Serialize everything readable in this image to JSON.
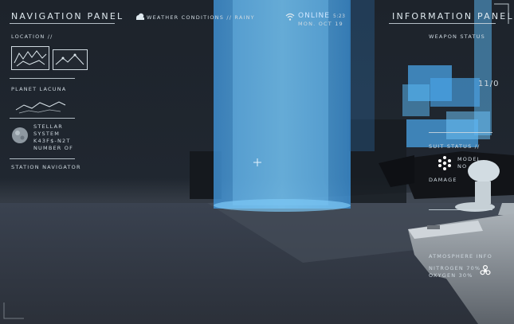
{
  "left_panel": {
    "title": "NAVIGATION PANEL",
    "location_label": "LOCATION //",
    "planet_label": "PLANET LACUNA",
    "system_lines": [
      "STELLAR",
      "SYSTEM",
      "K43F$-N2T",
      "NUMBER OF"
    ],
    "station_label": "STATION NAVIGATOR"
  },
  "top_bar": {
    "weather": "WEATHER CONDITIONS // RAINY",
    "status": "ONLINE",
    "time": "5:23",
    "date": "MON. OCT 19"
  },
  "right_panel": {
    "title": "INFORMATION PANEL",
    "weapon_status_label": "WEAPON STATUS",
    "ammo": "11/0",
    "suit_status_label": "SUIT STATUS //",
    "model_label": "MODEL",
    "model_value": "NO",
    "damage_label": "DAMAGE",
    "atmosphere_label": "ATMOSPHERE INFO",
    "nitrogen": "NITROGEN 70%",
    "oxygen": "OXYGEN 30%"
  },
  "colors": {
    "hud_text": "#dfe9ef",
    "hologram": "#4aa3e6",
    "online": "#cfe6ff"
  },
  "icons": [
    "cloud-icon",
    "wifi-icon",
    "crosshair-icon",
    "planet-icon",
    "biohazard-icon"
  ]
}
